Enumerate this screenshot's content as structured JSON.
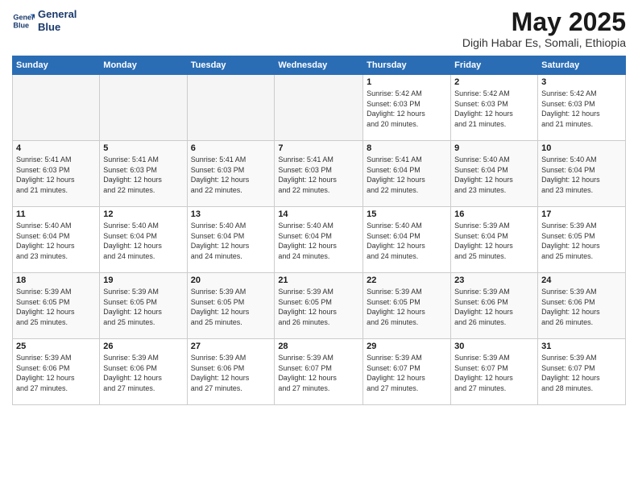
{
  "logo": {
    "line1": "General",
    "line2": "Blue"
  },
  "title": "May 2025",
  "subtitle": "Digih Habar Es, Somali, Ethiopia",
  "days_header": [
    "Sunday",
    "Monday",
    "Tuesday",
    "Wednesday",
    "Thursday",
    "Friday",
    "Saturday"
  ],
  "weeks": [
    [
      {
        "day": "",
        "info": ""
      },
      {
        "day": "",
        "info": ""
      },
      {
        "day": "",
        "info": ""
      },
      {
        "day": "",
        "info": ""
      },
      {
        "day": "1",
        "info": "Sunrise: 5:42 AM\nSunset: 6:03 PM\nDaylight: 12 hours\nand 20 minutes."
      },
      {
        "day": "2",
        "info": "Sunrise: 5:42 AM\nSunset: 6:03 PM\nDaylight: 12 hours\nand 21 minutes."
      },
      {
        "day": "3",
        "info": "Sunrise: 5:42 AM\nSunset: 6:03 PM\nDaylight: 12 hours\nand 21 minutes."
      }
    ],
    [
      {
        "day": "4",
        "info": "Sunrise: 5:41 AM\nSunset: 6:03 PM\nDaylight: 12 hours\nand 21 minutes."
      },
      {
        "day": "5",
        "info": "Sunrise: 5:41 AM\nSunset: 6:03 PM\nDaylight: 12 hours\nand 22 minutes."
      },
      {
        "day": "6",
        "info": "Sunrise: 5:41 AM\nSunset: 6:03 PM\nDaylight: 12 hours\nand 22 minutes."
      },
      {
        "day": "7",
        "info": "Sunrise: 5:41 AM\nSunset: 6:03 PM\nDaylight: 12 hours\nand 22 minutes."
      },
      {
        "day": "8",
        "info": "Sunrise: 5:41 AM\nSunset: 6:04 PM\nDaylight: 12 hours\nand 22 minutes."
      },
      {
        "day": "9",
        "info": "Sunrise: 5:40 AM\nSunset: 6:04 PM\nDaylight: 12 hours\nand 23 minutes."
      },
      {
        "day": "10",
        "info": "Sunrise: 5:40 AM\nSunset: 6:04 PM\nDaylight: 12 hours\nand 23 minutes."
      }
    ],
    [
      {
        "day": "11",
        "info": "Sunrise: 5:40 AM\nSunset: 6:04 PM\nDaylight: 12 hours\nand 23 minutes."
      },
      {
        "day": "12",
        "info": "Sunrise: 5:40 AM\nSunset: 6:04 PM\nDaylight: 12 hours\nand 24 minutes."
      },
      {
        "day": "13",
        "info": "Sunrise: 5:40 AM\nSunset: 6:04 PM\nDaylight: 12 hours\nand 24 minutes."
      },
      {
        "day": "14",
        "info": "Sunrise: 5:40 AM\nSunset: 6:04 PM\nDaylight: 12 hours\nand 24 minutes."
      },
      {
        "day": "15",
        "info": "Sunrise: 5:40 AM\nSunset: 6:04 PM\nDaylight: 12 hours\nand 24 minutes."
      },
      {
        "day": "16",
        "info": "Sunrise: 5:39 AM\nSunset: 6:04 PM\nDaylight: 12 hours\nand 25 minutes."
      },
      {
        "day": "17",
        "info": "Sunrise: 5:39 AM\nSunset: 6:05 PM\nDaylight: 12 hours\nand 25 minutes."
      }
    ],
    [
      {
        "day": "18",
        "info": "Sunrise: 5:39 AM\nSunset: 6:05 PM\nDaylight: 12 hours\nand 25 minutes."
      },
      {
        "day": "19",
        "info": "Sunrise: 5:39 AM\nSunset: 6:05 PM\nDaylight: 12 hours\nand 25 minutes."
      },
      {
        "day": "20",
        "info": "Sunrise: 5:39 AM\nSunset: 6:05 PM\nDaylight: 12 hours\nand 25 minutes."
      },
      {
        "day": "21",
        "info": "Sunrise: 5:39 AM\nSunset: 6:05 PM\nDaylight: 12 hours\nand 26 minutes."
      },
      {
        "day": "22",
        "info": "Sunrise: 5:39 AM\nSunset: 6:05 PM\nDaylight: 12 hours\nand 26 minutes."
      },
      {
        "day": "23",
        "info": "Sunrise: 5:39 AM\nSunset: 6:06 PM\nDaylight: 12 hours\nand 26 minutes."
      },
      {
        "day": "24",
        "info": "Sunrise: 5:39 AM\nSunset: 6:06 PM\nDaylight: 12 hours\nand 26 minutes."
      }
    ],
    [
      {
        "day": "25",
        "info": "Sunrise: 5:39 AM\nSunset: 6:06 PM\nDaylight: 12 hours\nand 27 minutes."
      },
      {
        "day": "26",
        "info": "Sunrise: 5:39 AM\nSunset: 6:06 PM\nDaylight: 12 hours\nand 27 minutes."
      },
      {
        "day": "27",
        "info": "Sunrise: 5:39 AM\nSunset: 6:06 PM\nDaylight: 12 hours\nand 27 minutes."
      },
      {
        "day": "28",
        "info": "Sunrise: 5:39 AM\nSunset: 6:07 PM\nDaylight: 12 hours\nand 27 minutes."
      },
      {
        "day": "29",
        "info": "Sunrise: 5:39 AM\nSunset: 6:07 PM\nDaylight: 12 hours\nand 27 minutes."
      },
      {
        "day": "30",
        "info": "Sunrise: 5:39 AM\nSunset: 6:07 PM\nDaylight: 12 hours\nand 27 minutes."
      },
      {
        "day": "31",
        "info": "Sunrise: 5:39 AM\nSunset: 6:07 PM\nDaylight: 12 hours\nand 28 minutes."
      }
    ]
  ]
}
